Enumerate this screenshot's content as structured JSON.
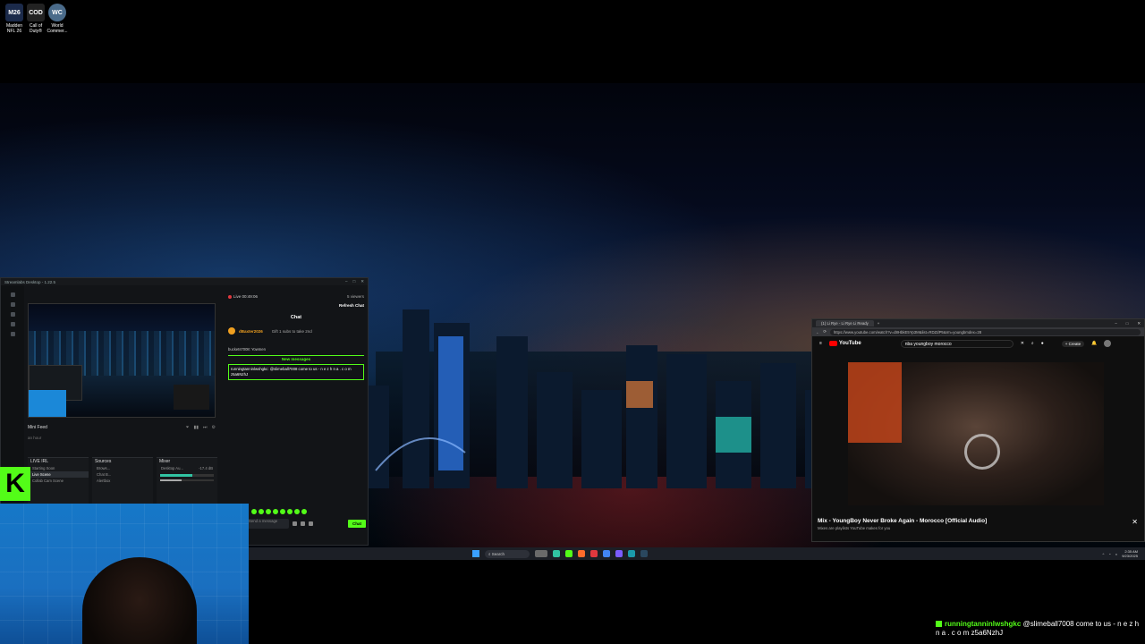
{
  "desktop_icons": [
    {
      "label": "Madden NFL 26",
      "glyph": "M26",
      "color": "#1b2a4a"
    },
    {
      "label": "Call of Duty®",
      "glyph": "COD",
      "color": "#222"
    },
    {
      "label": "World Commer...",
      "glyph": "WC",
      "color": "#4a6b8a"
    }
  ],
  "streamlabs": {
    "title": "Streamlabs Desktop - 1.22.5",
    "mini_feed_label": "Mini Feed",
    "mini_feed_row": "an hour",
    "scenes_header": "LIVE IRL",
    "scenes": [
      "Starting Soon",
      "Live Scene",
      "Collab Cam Scene"
    ],
    "sources_header": "Sources",
    "sources": [
      "Brows...",
      "Chat B...",
      "Alertbox"
    ],
    "mixer_header": "Mixer",
    "mixer_source": "Desktop Au...",
    "mixer_db": "-17.4 dB"
  },
  "kick_chat": {
    "live_time": "Live 00:49:06",
    "viewers": "5 viewers",
    "refresh_label": "Refresh Chat",
    "chat_title": "Chat",
    "pinned_user": "dBaxter2026",
    "pinned_gift": "Gift 1 subs to take 2nd",
    "message_1": "buckets7008: Yowmen",
    "new_messages_label": "New messages",
    "highlight_message": "runningtanninlwshgkc: @slimeball7008 come to us - n e z h n a . c o m z5a6NzhJ",
    "input_placeholder": "Send a message",
    "send_label": "Chat"
  },
  "youtube": {
    "tab_title": "(1) Li Rye - Li Rye Li Ready",
    "url": "https://www.youtube.com/watch?v=d8HbkE5Yp3M&list=RDZdP5&rm=youngbmdex=28",
    "logo_text": "YouTube",
    "search_value": "nba youngboy morocco",
    "create_label": "Create",
    "mix_title": "Mix - YoungBoy Never Broke Again - Morocco [Official Audio]",
    "mix_subtitle": "Mixes are playlists YouTube makes for you"
  },
  "taskbar": {
    "search_label": "Search",
    "time": "2:35 AM",
    "date": "9/23/2025"
  },
  "chat_overlay": {
    "username": "runningtanninlwshgkc",
    "message": "@slimeball7008 come to us - n e z h n a . c o m z5a6NzhJ"
  },
  "colors": {
    "kick_green": "#53fc18",
    "youtube_red": "#ff0000",
    "webcam_blue": "#1678c8"
  }
}
